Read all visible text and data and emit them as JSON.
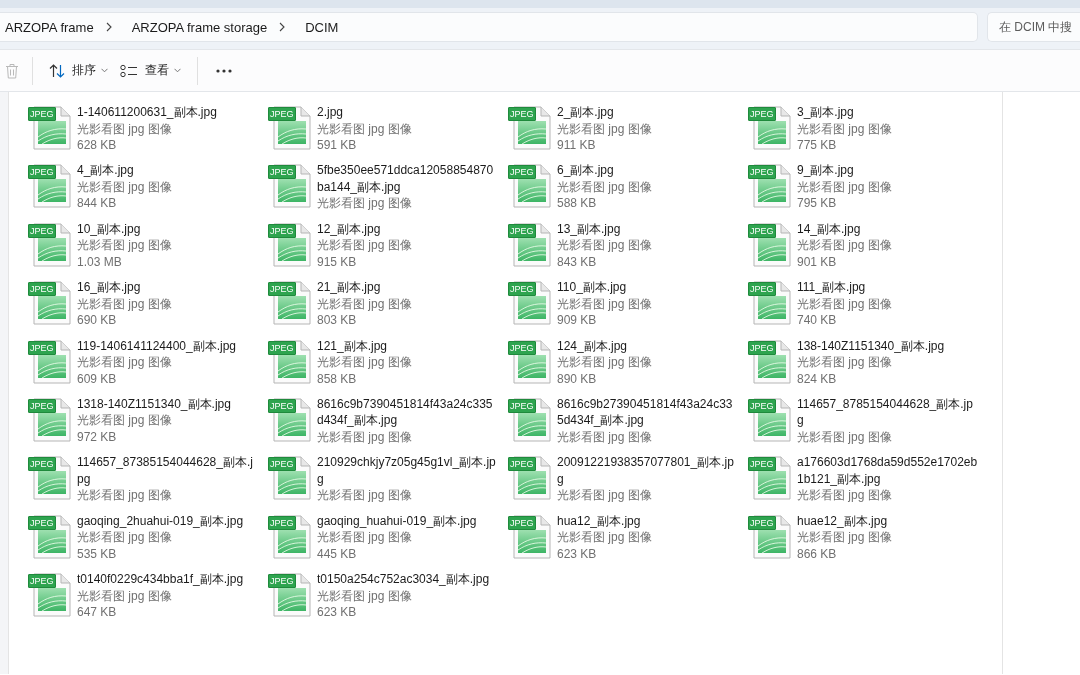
{
  "address_bar": {
    "breadcrumbs": [
      "ARZOPA frame",
      "ARZOPA frame storage",
      "DCIM"
    ]
  },
  "search": {
    "placeholder": "在 DCIM 中搜"
  },
  "toolbar": {
    "groups": [
      [
        {
          "kind": "delete",
          "disabled": true
        }
      ],
      [
        {
          "kind": "sort",
          "label": "排序",
          "disabled": false
        },
        {
          "kind": "view",
          "label": "查看",
          "disabled": false
        }
      ],
      [
        {
          "kind": "more",
          "disabled": false
        }
      ]
    ]
  },
  "files": [
    {
      "badge": "JPEG",
      "name": "1-140611200631_副本.jpg",
      "type": "光影看图 jpg 图像",
      "size": "628 KB"
    },
    {
      "badge": "JPEG",
      "name": "2.jpg",
      "type": "光影看图 jpg 图像",
      "size": "591 KB"
    },
    {
      "badge": "JPEG",
      "name": "2_副本.jpg",
      "type": "光影看图 jpg 图像",
      "size": "911 KB"
    },
    {
      "badge": "JPEG",
      "name": "3_副本.jpg",
      "type": "光影看图 jpg 图像",
      "size": "775 KB"
    },
    {
      "badge": "JPEG",
      "name": "4_副本.jpg",
      "type": "光影看图 jpg 图像",
      "size": "844 KB"
    },
    {
      "badge": "JPEG",
      "name": "5fbe350ee571ddca12058854870ba144_副本.jpg",
      "type": "光影看图 jpg 图像"
    },
    {
      "badge": "JPEG",
      "name": "6_副本.jpg",
      "type": "光影看图 jpg 图像",
      "size": "588 KB"
    },
    {
      "badge": "JPEG",
      "name": "9_副本.jpg",
      "type": "光影看图 jpg 图像",
      "size": "795 KB"
    },
    {
      "badge": "JPEG",
      "name": "10_副本.jpg",
      "type": "光影看图 jpg 图像",
      "size": "1.03 MB"
    },
    {
      "badge": "JPEG",
      "name": "12_副本.jpg",
      "type": "光影看图 jpg 图像",
      "size": "915 KB"
    },
    {
      "badge": "JPEG",
      "name": "13_副本.jpg",
      "type": "光影看图 jpg 图像",
      "size": "843 KB"
    },
    {
      "badge": "JPEG",
      "name": "14_副本.jpg",
      "type": "光影看图 jpg 图像",
      "size": "901 KB"
    },
    {
      "badge": "JPEG",
      "name": "16_副本.jpg",
      "type": "光影看图 jpg 图像",
      "size": "690 KB"
    },
    {
      "badge": "JPEG",
      "name": "21_副本.jpg",
      "type": "光影看图 jpg 图像",
      "size": "803 KB"
    },
    {
      "badge": "JPEG",
      "name": "110_副本.jpg",
      "type": "光影看图 jpg 图像",
      "size": "909 KB"
    },
    {
      "badge": "JPEG",
      "name": "111_副本.jpg",
      "type": "光影看图 jpg 图像",
      "size": "740 KB"
    },
    {
      "badge": "JPEG",
      "name": "119-1406141124400_副本.jpg",
      "type": "光影看图 jpg 图像",
      "size": "609 KB"
    },
    {
      "badge": "JPEG",
      "name": "121_副本.jpg",
      "type": "光影看图 jpg 图像",
      "size": "858 KB"
    },
    {
      "badge": "JPEG",
      "name": "124_副本.jpg",
      "type": "光影看图 jpg 图像",
      "size": "890 KB"
    },
    {
      "badge": "JPEG",
      "name": "138-140Z1151340_副本.jpg",
      "type": "光影看图 jpg 图像",
      "size": "824 KB"
    },
    {
      "badge": "JPEG",
      "name": "1318-140Z1151340_副本.jpg",
      "type": "光影看图 jpg 图像",
      "size": "972 KB"
    },
    {
      "badge": "JPEG",
      "name": "8616c9b7390451814f43a24c335d434f_副本.jpg",
      "type": "光影看图 jpg 图像"
    },
    {
      "badge": "JPEG",
      "name": "8616c9b27390451814f43a24c335d434f_副本.jpg",
      "type": "光影看图 jpg 图像"
    },
    {
      "badge": "JPEG",
      "name": "114657_8785154044628_副本.jpg",
      "type": "光影看图 jpg 图像"
    },
    {
      "badge": "JPEG",
      "name": "114657_87385154044628_副本.jpg",
      "type": "光影看图 jpg 图像"
    },
    {
      "badge": "JPEG",
      "name": "210929chkjy7z05g45g1vl_副本.jpg",
      "type": "光影看图 jpg 图像"
    },
    {
      "badge": "JPEG",
      "name": "20091221938357077801_副本.jpg",
      "type": "光影看图 jpg 图像"
    },
    {
      "badge": "JPEG",
      "name": "a176603d1768da59d552e1702eb1b121_副本.jpg",
      "type": "光影看图 jpg 图像"
    },
    {
      "badge": "JPEG",
      "name": "gaoqing_2huahui-019_副本.jpg",
      "type": "光影看图 jpg 图像",
      "size": "535 KB"
    },
    {
      "badge": "JPEG",
      "name": "gaoqing_huahui-019_副本.jpg",
      "type": "光影看图 jpg 图像",
      "size": "445 KB"
    },
    {
      "badge": "JPEG",
      "name": "hua12_副本.jpg",
      "type": "光影看图 jpg 图像",
      "size": "623 KB"
    },
    {
      "badge": "JPEG",
      "name": "huae12_副本.jpg",
      "type": "光影看图 jpg 图像",
      "size": "866 KB"
    },
    {
      "badge": "JPEG",
      "name": "t0140f0229c434bba1f_副本.jpg",
      "type": "光影看图 jpg 图像",
      "size": "647 KB"
    },
    {
      "badge": "JPEG",
      "name": "t0150a254c752ac3034_副本.jpg",
      "type": "光影看图 jpg 图像",
      "size": "623 KB"
    }
  ]
}
